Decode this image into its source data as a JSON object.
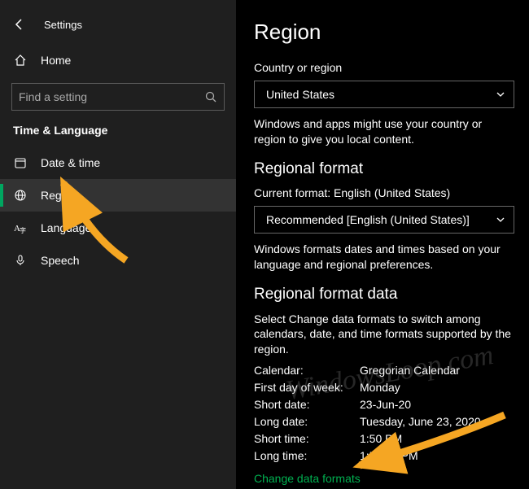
{
  "app": {
    "title": "Settings"
  },
  "sidebar": {
    "home": "Home",
    "search_placeholder": "Find a setting",
    "category": "Time & Language",
    "items": [
      {
        "label": "Date & time"
      },
      {
        "label": "Region"
      },
      {
        "label": "Language"
      },
      {
        "label": "Speech"
      }
    ]
  },
  "main": {
    "title": "Region",
    "country_label": "Country or region",
    "country_value": "United States",
    "country_desc": "Windows and apps might use your country or region to give you local content.",
    "format_head": "Regional format",
    "format_label": "Current format: English (United States)",
    "format_value": "Recommended [English (United States)]",
    "format_desc": "Windows formats dates and times based on your language and regional preferences.",
    "data_head": "Regional format data",
    "data_desc": "Select Change data formats to switch among calendars, date, and time formats supported by the region.",
    "rows": {
      "calendar_k": "Calendar:",
      "calendar_v": "Gregorian Calendar",
      "firstday_k": "First day of week:",
      "firstday_v": "Monday",
      "shortdate_k": "Short date:",
      "shortdate_v": "23-Jun-20",
      "longdate_k": "Long date:",
      "longdate_v": "Tuesday, June 23, 2020",
      "shorttime_k": "Short time:",
      "shorttime_v": "1:50 PM",
      "longtime_k": "Long time:",
      "longtime_v": "1:50:36 PM"
    },
    "link": "Change data formats"
  },
  "watermark": "WindowsLoop.com"
}
